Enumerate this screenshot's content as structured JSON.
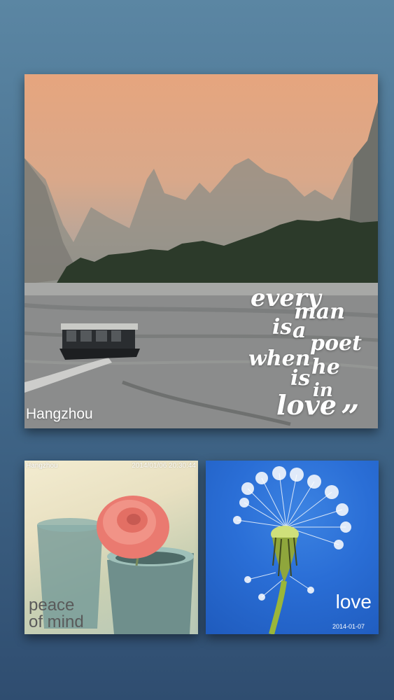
{
  "hero": {
    "location": "Hangzhou",
    "quote_words": [
      "every",
      "man",
      "is",
      "a",
      "poet",
      "when",
      "he",
      "is",
      "in",
      "love"
    ],
    "quote_mark": "”"
  },
  "peace_card": {
    "location": "Hangzhou",
    "timestamp": "2014/01/06 20:30:44",
    "caption_line1": "peace",
    "caption_line2": "of mind"
  },
  "love_card": {
    "word": "love",
    "date": "2014-01-07"
  },
  "colors": {
    "background_top": "#5b86a3",
    "background_bottom": "#2f4d70",
    "sky": "#e6a57e",
    "dandelion_sky": "#2a6ed6"
  }
}
